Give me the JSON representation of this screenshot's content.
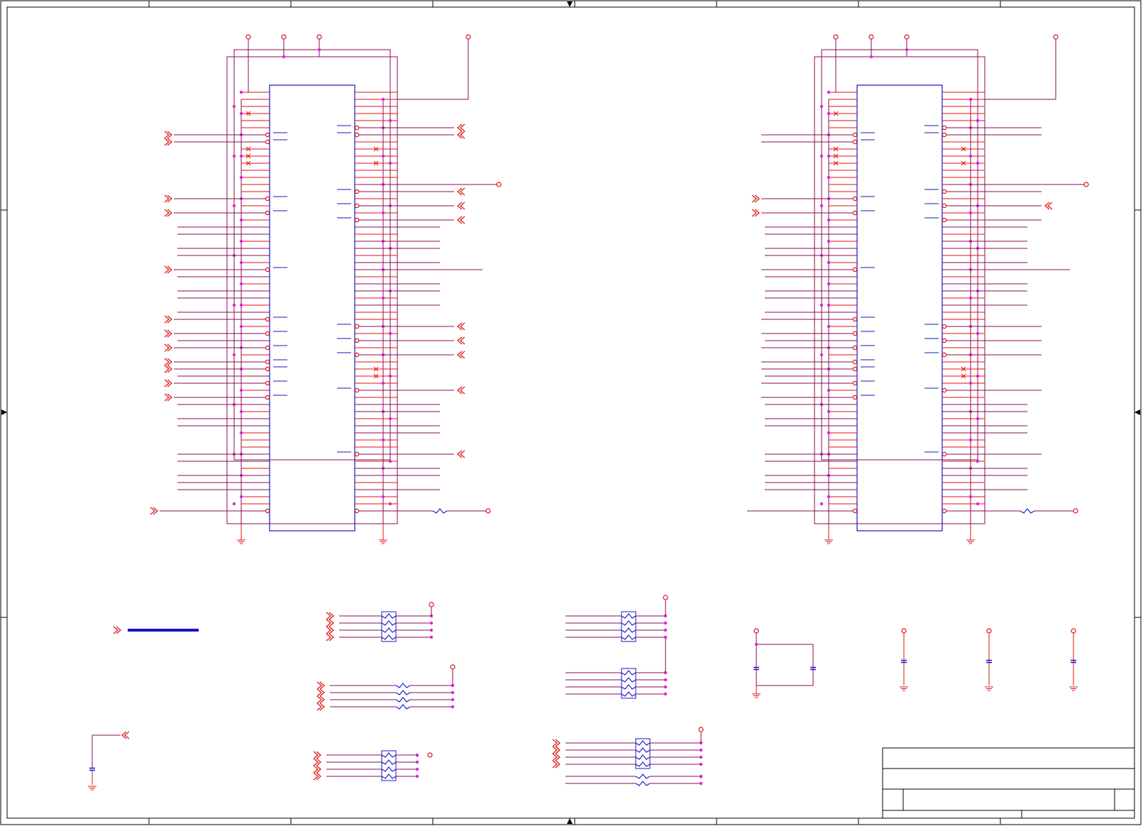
{
  "sheet": {
    "title_text": "",
    "revision": "",
    "sheet_number": ""
  },
  "colors": {
    "wire": "#8b0a50",
    "pin": "#e01010",
    "body": "#1414c8",
    "junction": "#e020e0",
    "frame": "#000000",
    "port": "#e01010"
  },
  "icons": [
    "off-page-connector-icon",
    "power-port-icon",
    "ground-symbol-icon",
    "resistor-network-icon",
    "capacitor-icon",
    "resistor-icon",
    "no-connect-icon",
    "junction-dot-icon"
  ],
  "connectors": [
    {
      "name": "connector-left"
    },
    {
      "name": "connector-right"
    }
  ]
}
